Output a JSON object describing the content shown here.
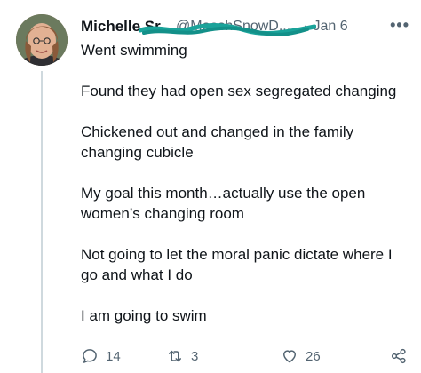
{
  "tweet": {
    "author_name": "Michelle Sr...",
    "handle": "@MooshSnowD...",
    "separator": "·",
    "date": "Jan 6",
    "more_label": "•••",
    "paragraphs": [
      "Went swimming",
      "Found they had open sex segregated changing",
      "Chickened out and changed in the family changing cubicle",
      "My goal this month…actually use the open women’s changing room",
      "Not going to let the moral panic dictate where I go and what I do",
      "I am going to swim"
    ],
    "actions": {
      "replies": "14",
      "retweets": "3",
      "likes": "26"
    }
  },
  "icons": {
    "reply": "reply-icon",
    "retweet": "retweet-icon",
    "like": "heart-icon",
    "share": "share-icon",
    "more": "more-icon"
  },
  "colors": {
    "text": "#0f1419",
    "secondary": "#536471",
    "thread_line": "#cfd9de",
    "redaction": "#1aa39a"
  }
}
